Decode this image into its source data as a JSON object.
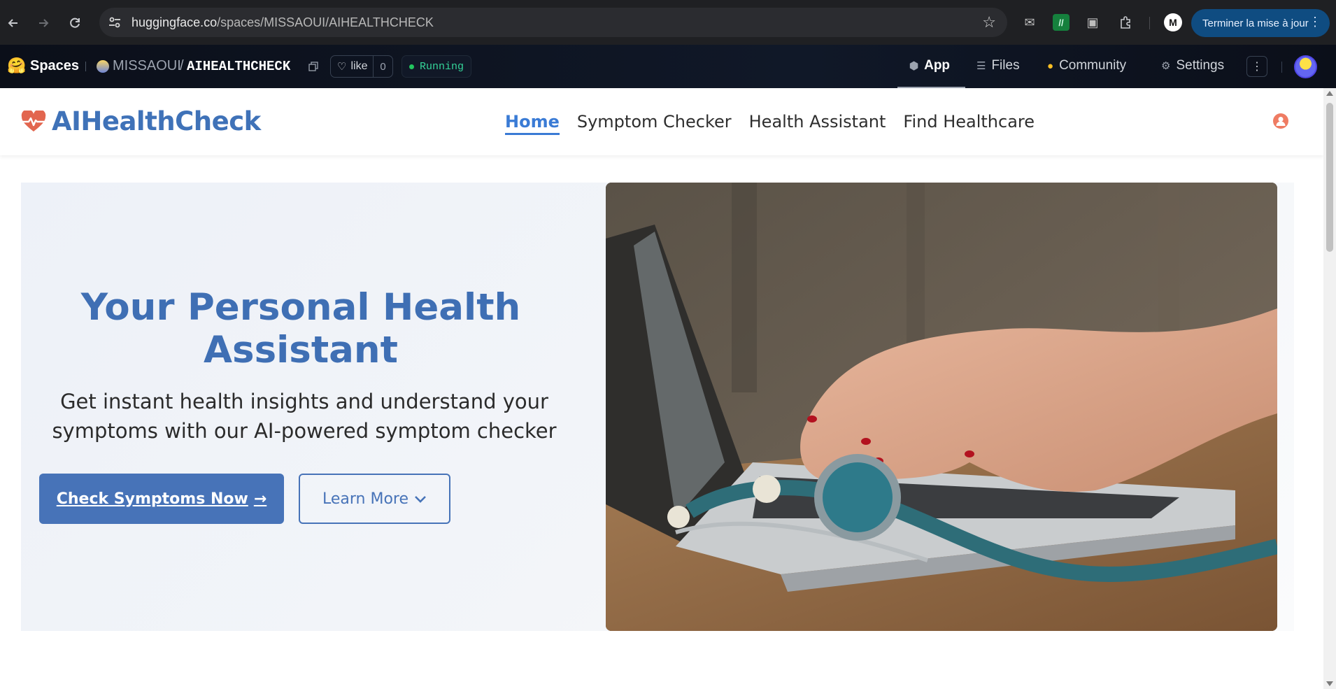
{
  "browser": {
    "url_host": "huggingface.co",
    "url_path": "/spaces/MISSAOUI/AIHEALTHCHECK",
    "update_button_label": "Terminer la mise à jour",
    "icons": [
      "back-arrow-icon",
      "forward-arrow-icon",
      "reload-icon",
      "site-info-icon",
      "star-icon",
      "mail-icon",
      "vscode-ext-icon",
      "cast-icon",
      "extensions-icon",
      "profile-icon",
      "kebab-menu-icon"
    ],
    "update_button_color": "#0f4c81"
  },
  "hf": {
    "spaces_label": "Spaces",
    "owner": "MISSAOUI",
    "separator": "/",
    "repo": "AIHEALTHCHECK",
    "like_label": "like",
    "like_count": "0",
    "status": "Running",
    "tabs": [
      {
        "label": "App",
        "icon": "cube-icon",
        "active": true
      },
      {
        "label": "Files",
        "icon": "files-icon",
        "active": false
      },
      {
        "label": "Community",
        "icon": "community-icon",
        "active": false
      },
      {
        "label": "Settings",
        "icon": "gear-icon",
        "active": false
      }
    ],
    "status_color": "#22c55e"
  },
  "app": {
    "brand": "AIHealthCheck",
    "menu": [
      {
        "label": "Home",
        "active": true
      },
      {
        "label": "Symptom Checker",
        "active": false
      },
      {
        "label": "Health Assistant",
        "active": false
      },
      {
        "label": "Find Healthcare",
        "active": false
      }
    ],
    "hero": {
      "title": "Your Personal Health Assistant",
      "subtitle": "Get instant health insights and understand your symptoms with our AI-powered symptom checker",
      "primary_button": "Check Symptoms Now",
      "secondary_button": "Learn More",
      "image_description_icon": "laptop-stethoscope-photo"
    },
    "colors": {
      "brand": "#3f72b8",
      "accent": "#4773b8",
      "active_link": "#3a7bd5",
      "user_icon": "#ef7c63"
    }
  }
}
